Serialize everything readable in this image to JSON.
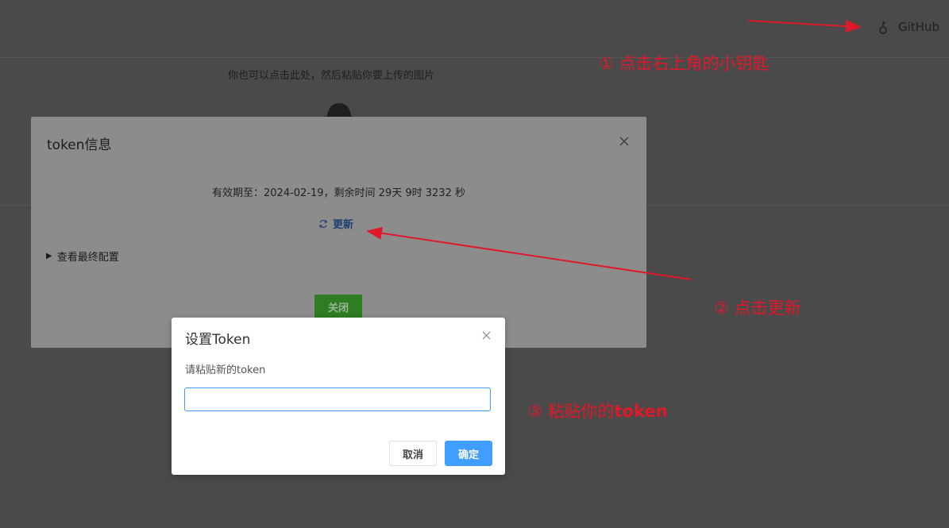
{
  "header": {
    "github_label": "GitHub"
  },
  "upload": {
    "hint": "你也可以点击此处，然后粘贴你要上传的图片"
  },
  "token_dialog": {
    "title": "token信息",
    "expiry": "有效期至：2024-02-19，剩余时间 29天 9时 3232 秒",
    "refresh_label": "更新",
    "final_config_label": "查看最终配置",
    "close_button": "关闭"
  },
  "set_token_dialog": {
    "title": "设置Token",
    "label": "请粘贴新的token",
    "input_value": "",
    "cancel_button": "取消",
    "confirm_button": "确定"
  },
  "annotations": {
    "step1": "① 点击右上角的小钥匙",
    "step2": "② 点击更新",
    "step3_prefix": "③ 粘贴你的",
    "step3_bold": "token"
  },
  "icons": {
    "key": "key-icon",
    "refresh": "refresh-icon",
    "close": "close-icon",
    "triangle": "triangle-right-icon",
    "cloud": "cloud-upload-icon"
  },
  "colors": {
    "overlay_bg": "#4a4a4a",
    "annotation_red": "#e0192a",
    "primary_blue": "#409eff",
    "close_green": "#2e7d23"
  }
}
